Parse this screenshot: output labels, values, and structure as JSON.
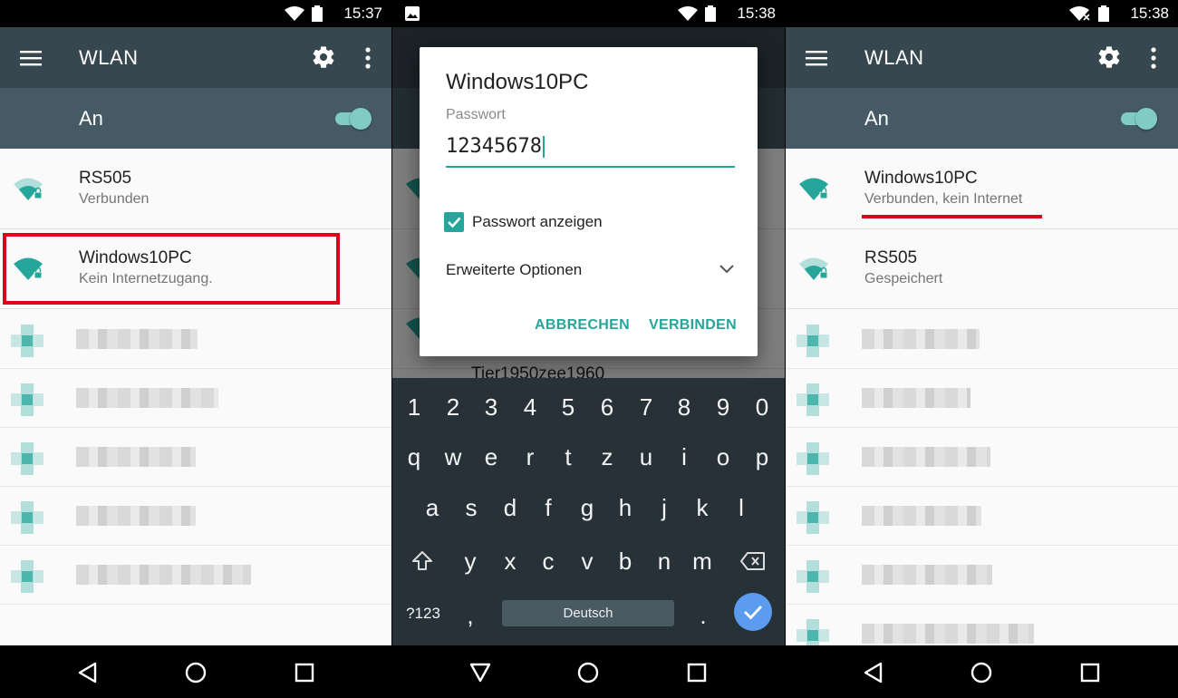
{
  "panels": [
    {
      "status": {
        "time": "15:37"
      },
      "appbar": {
        "title": "WLAN",
        "menu_icon": "hamburger-menu-icon",
        "settings_icon": "gear-icon",
        "more_icon": "more-vert-icon"
      },
      "switch": {
        "label": "An",
        "on": true
      },
      "networks": [
        {
          "name": "RS505",
          "sub": "Verbunden"
        },
        {
          "name": "Windows10PC",
          "sub": "Kein Internetzugang."
        }
      ]
    },
    {
      "status": {
        "time": "15:38"
      },
      "background_network": "Tier1950zee1960",
      "dialog": {
        "title": "Windows10PC",
        "password_label": "Passwort",
        "password_value": "12345678",
        "show_password_label": "Passwort anzeigen",
        "show_password_checked": true,
        "advanced_label": "Erweiterte Optionen",
        "cancel_label": "ABBRECHEN",
        "connect_label": "VERBINDEN"
      },
      "keyboard": {
        "row1": [
          "1",
          "2",
          "3",
          "4",
          "5",
          "6",
          "7",
          "8",
          "9",
          "0"
        ],
        "row2": [
          "q",
          "w",
          "e",
          "r",
          "t",
          "z",
          "u",
          "i",
          "o",
          "p"
        ],
        "row3": [
          "a",
          "s",
          "d",
          "f",
          "g",
          "h",
          "j",
          "k",
          "l"
        ],
        "row4": [
          "y",
          "x",
          "c",
          "v",
          "b",
          "n",
          "m"
        ],
        "symbols_key": "?123",
        "comma_key": ",",
        "space_label": "Deutsch",
        "period_key": "."
      }
    },
    {
      "status": {
        "time": "15:38"
      },
      "appbar": {
        "title": "WLAN"
      },
      "switch": {
        "label": "An",
        "on": true
      },
      "networks": [
        {
          "name": "Windows10PC",
          "sub": "Verbunden, kein Internet"
        },
        {
          "name": "RS505",
          "sub": "Gespeichert"
        }
      ]
    }
  ],
  "colors": {
    "accent": "#26a69a",
    "appbar": "#37474f",
    "switchbar": "#455a64",
    "highlight": "#e0001a"
  }
}
